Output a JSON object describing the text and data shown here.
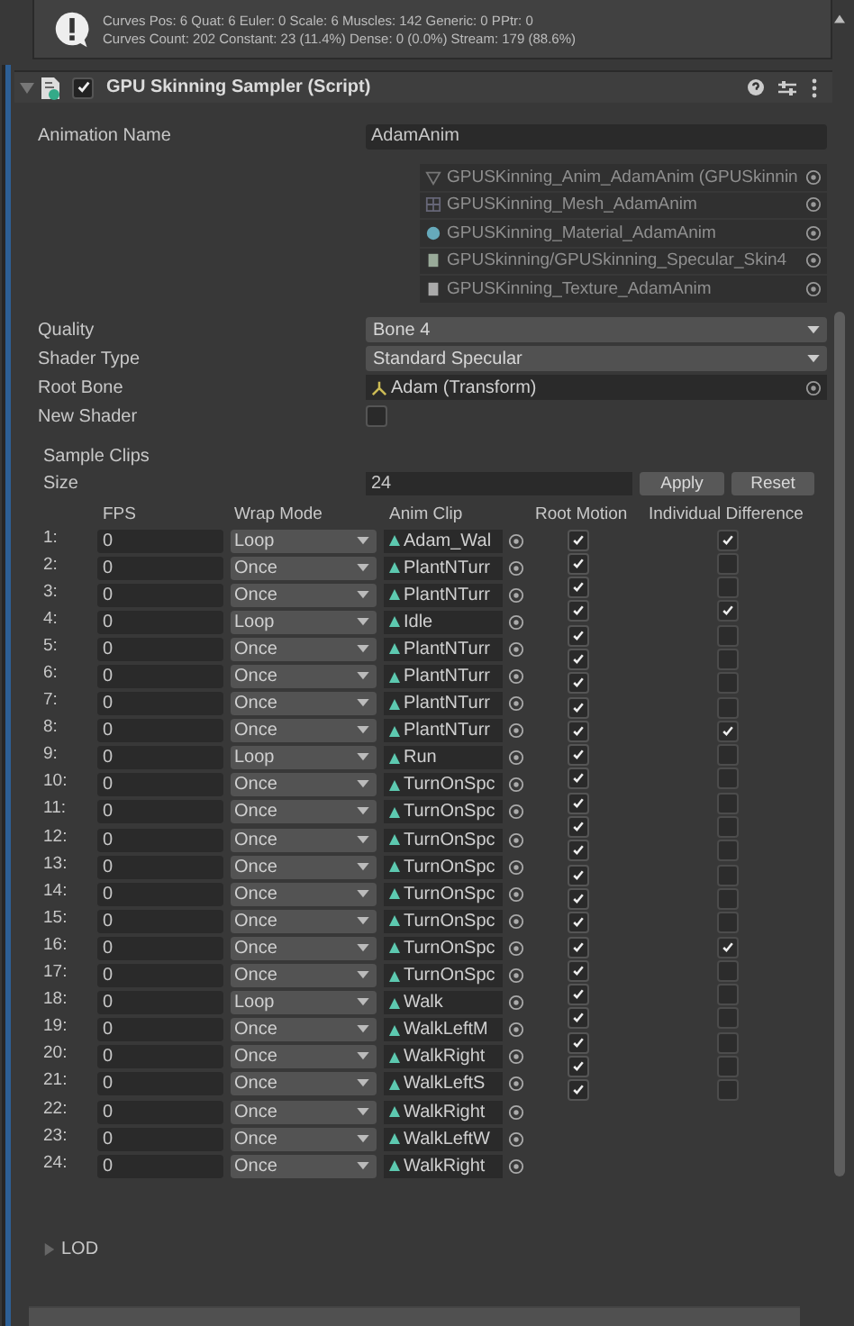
{
  "info_box": {
    "lines": [
      "Curves Pos: 6 Quat: 6 Euler: 0 Scale: 6 Muscles: 142 Generic: 0 PPtr: 0",
      "Curves Count: 202 Constant: 23 (11.4%) Dense: 0 (0.0%) Stream: 179 (88.6%)"
    ]
  },
  "component": {
    "title": "GPU Skinning Sampler (Script)",
    "expanded": true,
    "enabled": true
  },
  "animation_name": {
    "label": "Animation Name",
    "value": "AdamAnim"
  },
  "assets": [
    {
      "kind": "anim",
      "name": "GPUSKinning_Anim_AdamAnim (GPUSkinnin"
    },
    {
      "kind": "mesh",
      "name": "GPUSKinning_Mesh_AdamAnim"
    },
    {
      "kind": "material",
      "name": "GPUSKinning_Material_AdamAnim"
    },
    {
      "kind": "shader",
      "name": "GPUSkinning/GPUSkinning_Specular_Skin4"
    },
    {
      "kind": "texture",
      "name": "GPUSKinning_Texture_AdamAnim"
    }
  ],
  "fields": [
    {
      "kind": "dropdown",
      "label": "Quality",
      "value": "Bone 4"
    },
    {
      "kind": "dropdown",
      "label": "Shader Type",
      "value": "Standard Specular"
    },
    {
      "kind": "object",
      "label": "Root Bone",
      "value": "Adam (Transform)"
    },
    {
      "kind": "checkbox",
      "label": "New Shader",
      "checked": false
    }
  ],
  "sample_clips": {
    "title": "Sample Clips",
    "size_label": "Size",
    "size": "24",
    "buttons": [
      "Apply",
      "Reset"
    ],
    "columns": [
      "FPS",
      "Wrap Mode",
      "Anim Clip",
      "Root Motion",
      "Individual Difference"
    ],
    "rows": [
      {
        "index": "1:",
        "fps": "0",
        "wrap": "Loop",
        "clip": "Adam_Wal"
      },
      {
        "index": "2:",
        "fps": "0",
        "wrap": "Once",
        "clip": "PlantNTurr"
      },
      {
        "index": "3:",
        "fps": "0",
        "wrap": "Once",
        "clip": "PlantNTurr"
      },
      {
        "index": "4:",
        "fps": "0",
        "wrap": "Loop",
        "clip": "Idle"
      },
      {
        "index": "5:",
        "fps": "0",
        "wrap": "Once",
        "clip": "PlantNTurr"
      },
      {
        "index": "6:",
        "fps": "0",
        "wrap": "Once",
        "clip": "PlantNTurr"
      },
      {
        "index": "7:",
        "fps": "0",
        "wrap": "Once",
        "clip": "PlantNTurr"
      },
      {
        "index": "8:",
        "fps": "0",
        "wrap": "Once",
        "clip": "PlantNTurr"
      },
      {
        "index": "9:",
        "fps": "0",
        "wrap": "Loop",
        "clip": "Run"
      },
      {
        "index": "10:",
        "fps": "0",
        "wrap": "Once",
        "clip": "TurnOnSpc"
      },
      {
        "index": "11:",
        "fps": "0",
        "wrap": "Once",
        "clip": "TurnOnSpc"
      },
      {
        "index": "12:",
        "fps": "0",
        "wrap": "Once",
        "clip": "TurnOnSpc"
      },
      {
        "index": "13:",
        "fps": "0",
        "wrap": "Once",
        "clip": "TurnOnSpc"
      },
      {
        "index": "14:",
        "fps": "0",
        "wrap": "Once",
        "clip": "TurnOnSpc"
      },
      {
        "index": "15:",
        "fps": "0",
        "wrap": "Once",
        "clip": "TurnOnSpc"
      },
      {
        "index": "16:",
        "fps": "0",
        "wrap": "Once",
        "clip": "TurnOnSpc"
      },
      {
        "index": "17:",
        "fps": "0",
        "wrap": "Once",
        "clip": "TurnOnSpc"
      },
      {
        "index": "18:",
        "fps": "0",
        "wrap": "Loop",
        "clip": "Walk"
      },
      {
        "index": "19:",
        "fps": "0",
        "wrap": "Once",
        "clip": "WalkLeftM"
      },
      {
        "index": "20:",
        "fps": "0",
        "wrap": "Once",
        "clip": "WalkRight"
      },
      {
        "index": "21:",
        "fps": "0",
        "wrap": "Once",
        "clip": "WalkLeftS"
      },
      {
        "index": "22:",
        "fps": "0",
        "wrap": "Once",
        "clip": "WalkRight"
      },
      {
        "index": "23:",
        "fps": "0",
        "wrap": "Once",
        "clip": "WalkLeftW"
      },
      {
        "index": "24:",
        "fps": "0",
        "wrap": "Once",
        "clip": "WalkRight"
      }
    ],
    "root_motion": [
      {
        "checked": true
      },
      {
        "checked": true
      },
      {
        "checked": true
      },
      {
        "checked": true
      },
      {
        "checked": true
      },
      {
        "checked": true
      },
      {
        "checked": true
      },
      {
        "checked": true
      },
      {
        "checked": true
      },
      {
        "checked": true
      },
      {
        "checked": true
      },
      {
        "checked": true
      },
      {
        "checked": true
      },
      {
        "checked": true
      },
      {
        "checked": true
      },
      {
        "checked": true
      },
      {
        "checked": true
      },
      {
        "checked": true
      },
      {
        "checked": true
      },
      {
        "checked": true
      },
      {
        "checked": true
      },
      {
        "checked": true
      },
      {
        "checked": true
      },
      {
        "checked": true
      }
    ],
    "individual_difference": [
      {
        "checked": true
      },
      {
        "checked": false
      },
      {
        "checked": false
      },
      {
        "checked": true
      },
      {
        "checked": false
      },
      {
        "checked": false
      },
      {
        "checked": false
      },
      {
        "checked": false
      },
      {
        "checked": true
      },
      {
        "checked": false
      },
      {
        "checked": false
      },
      {
        "checked": false
      },
      {
        "checked": false
      },
      {
        "checked": false
      },
      {
        "checked": false
      },
      {
        "checked": false
      },
      {
        "checked": false
      },
      {
        "checked": true
      },
      {
        "checked": false
      },
      {
        "checked": false
      },
      {
        "checked": false
      },
      {
        "checked": false
      },
      {
        "checked": false
      },
      {
        "checked": false
      }
    ]
  },
  "lod": {
    "label": "LOD",
    "expanded": false
  }
}
